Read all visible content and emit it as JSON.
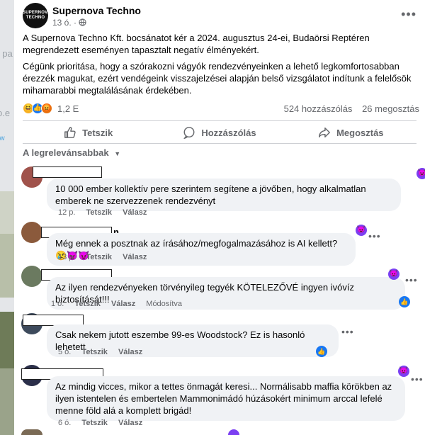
{
  "left_strip": {
    "fragments": [
      "ĭ pa",
      "o.e",
      "-w"
    ]
  },
  "post": {
    "page_name": "Supernova Techno",
    "logo_text": "SUPERNOVA TECHNO",
    "time": "13 ó. · ",
    "paragraph1": "A Supernova Techno Kft. bocsánatot kér a 2024. augusztus 24-ei, Budaörsi Reptéren megrendezett eseményen tapasztalt negatív élményekért.",
    "paragraph2": "Cégünk prioritása, hogy a szórakozni vágyók rendezvényeinken a lehető legkomfortosabban érezzék magukat, ezért vendégeink visszajelzései alapján belső vizsgálatot indítunk a felelősök mihamarabbi megtalálásának érdekében.",
    "reaction_count": "1,2 E",
    "comments_count": "524 hozzászólás",
    "shares_count": "26 megosztás",
    "more_icon": "more-horizontal-icon"
  },
  "actions": {
    "like": "Tetszik",
    "comment": "Hozzászólás",
    "share": "Megosztás"
  },
  "sort_label": "A legrelevánsabbak",
  "comments": [
    {
      "text": "10 000 ember kollektív pere szerintem segítene a jövőben, hogy alkalmatlan emberek ne szervezzenek rendezvényt",
      "time": "12 p.",
      "like": "Tetszik",
      "reply": "Válasz"
    },
    {
      "name_fragment": "n",
      "text": "Még ennek a posztnak az írásához/megfogalmazásához is AI kellett?😢😈😈",
      "time": "13 p.",
      "like": "Tetszik",
      "reply": "Válasz"
    },
    {
      "text": "Az ilyen rendezvényeken törvényileg tegyék KÖTELEZŐVÉ ingyen ivóvíz biztosítását!!!",
      "time": "1 ó.",
      "like": "Tetszik",
      "reply": "Válasz",
      "edited": "Módosítva"
    },
    {
      "text": "Csak nekem jutott eszembe 99-es Woodstock? Ez is hasonló lehetett",
      "time": "5 ó.",
      "like": "Tetszik",
      "reply": "Válasz"
    },
    {
      "text": "Az mindig vicces, mikor a tettes önmagát keresi... Normálisabb maffia körökben az ilyen istentelen és embertelen Mammonimádó húzásokért minimum arccal lefelé menne föld alá a komplett brigád!",
      "time": "6 ó.",
      "like": "Tetszik",
      "reply": "Válasz"
    }
  ],
  "colors": {
    "accent": "#1877f2",
    "secondary_text": "#65676b",
    "bubble": "#f0f2f5",
    "reaction_purple": "#7b3ff2"
  }
}
